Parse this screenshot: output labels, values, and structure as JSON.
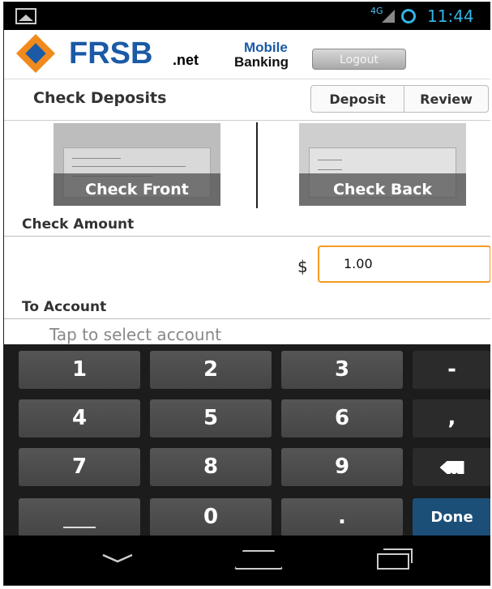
{
  "status_bar": {
    "network": "4G",
    "time": "11:44"
  },
  "header": {
    "brand_name": "FRSB",
    "brand_suffix": ".net",
    "mobile_label": "Mobile",
    "banking_label": "Banking",
    "logout_label": "Logout"
  },
  "title_bar": {
    "title": "Check Deposits",
    "tabs": [
      {
        "label": "Deposit"
      },
      {
        "label": "Review"
      }
    ]
  },
  "check_images": {
    "front_label": "Check Front",
    "back_label": "Check Back"
  },
  "amount": {
    "header": "Check Amount",
    "currency_symbol": "$",
    "value": "1.00"
  },
  "account": {
    "header": "To Account",
    "placeholder": "Tap to select account"
  },
  "keyboard": {
    "keys": [
      "1",
      "2",
      "3",
      "-",
      "4",
      "5",
      "6",
      ",",
      "7",
      "8",
      "9",
      "0",
      "."
    ],
    "done_label": "Done"
  },
  "colors": {
    "accent": "#f59a23",
    "brand_blue": "#1a5aa6",
    "brand_orange": "#f08a1c",
    "done_key": "#1c4f78"
  }
}
